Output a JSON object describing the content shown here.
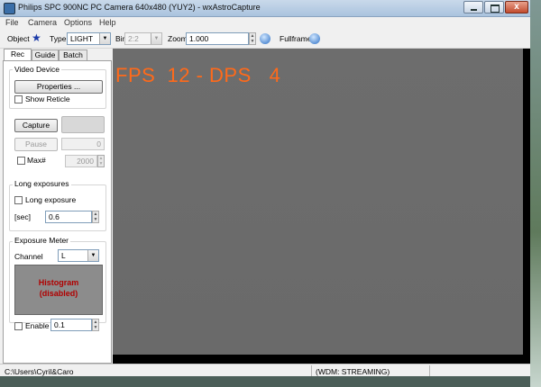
{
  "window": {
    "title": "Philips SPC 900NC PC Camera 640x480 (YUY2) - wxAstroCapture",
    "close_glyph": "x"
  },
  "menu": [
    "File",
    "Camera",
    "Options",
    "Help"
  ],
  "toolbar": {
    "object_label": "Object",
    "type_label": "Type",
    "type_value": "LIGHT",
    "bin_label": "Bin",
    "bin_value": "2:2",
    "zoom_label": "Zoom",
    "zoom_value": "1.000",
    "fullframe_label": "Fullframe"
  },
  "tabs": [
    "Rec",
    "Guide",
    "Batch"
  ],
  "video_device": {
    "group_label": "Video Device",
    "properties_label": "Properties ...",
    "show_reticle_label": "Show Reticle"
  },
  "capture": {
    "capture_label": "Capture",
    "pause_label": "Pause",
    "pause_value": "0",
    "max_label": "Max#",
    "max_value": "2000"
  },
  "long_exposures": {
    "group_label": "Long exposures",
    "checkbox_label": "Long exposure",
    "sec_label": "[sec]",
    "sec_value": "0.6"
  },
  "exposure_meter": {
    "group_label": "Exposure Meter",
    "channel_label": "Channel",
    "channel_value": "L",
    "histogram_line1": "Histogram",
    "histogram_line2": "(disabled)",
    "enable_label": "Enable",
    "enable_value": "0.1"
  },
  "viewer": {
    "overlay": "FPS  12 - DPS   4",
    "overlay_color": "#ff6a1a"
  },
  "status": {
    "path": "C:\\Users\\Cyril&Caro",
    "streaming": "(WDM: STREAMING)"
  }
}
